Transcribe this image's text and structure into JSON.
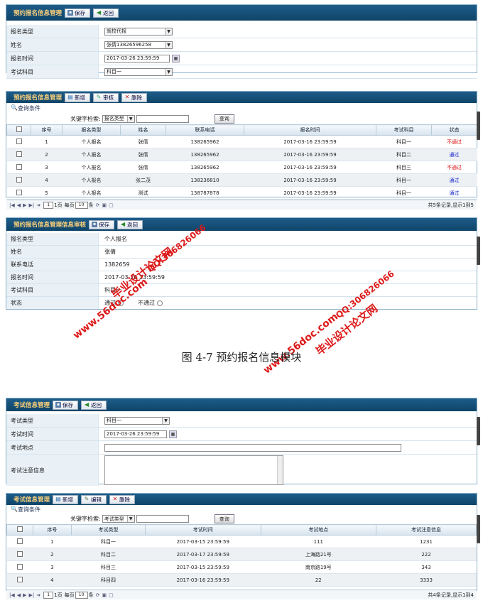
{
  "panel1": {
    "title": "预约报名信息管理",
    "save_label": "保存",
    "back_label": "返回",
    "fields": [
      {
        "label": "报名类型",
        "value": "就校代报",
        "kind": "select"
      },
      {
        "label": "姓名",
        "value": "张倩13826596258",
        "kind": "select"
      },
      {
        "label": "报名时间",
        "value": "2017-03-26 23:59:59",
        "kind": "date"
      },
      {
        "label": "考试科目",
        "value": "科目一",
        "kind": "select"
      }
    ]
  },
  "panel2": {
    "title": "预约报名信息管理",
    "add_label": "新增",
    "audit_label": "审核",
    "delete_label": "删除",
    "query_conditions": "查询条件",
    "keyword_label": "关键字检索:",
    "keyword_select": "报名类型",
    "query_button": "查询",
    "columns": [
      "序号",
      "报名类型",
      "姓名",
      "联系电话",
      "报名时间",
      "考试科目",
      "状态"
    ],
    "rows": [
      [
        "1",
        "个人报名",
        "张倩",
        "138265962",
        "2017-03-16 23:59:59",
        "科目一",
        "不通过"
      ],
      [
        "2",
        "个人报名",
        "张倩",
        "138265962",
        "2017-03-16 23:59:59",
        "科目二",
        "通过"
      ],
      [
        "3",
        "个人报名",
        "张倩",
        "138265962",
        "2017-03-16 23:59:59",
        "科目三",
        "不通过"
      ],
      [
        "4",
        "个人报名",
        "张二茂",
        "138236810",
        "2017-03-16 23:59:59",
        "科目一",
        "通过"
      ],
      [
        "5",
        "个人报名",
        "测试",
        "138787878",
        "2017-03-16 23:59:59",
        "科目一",
        "通过"
      ]
    ],
    "pager": {
      "page": "1",
      "total_pages": "1页",
      "per_page_label": "每页",
      "per_page": "10",
      "unit": "条",
      "summary": "共5条记录,显示1到5"
    }
  },
  "panel3": {
    "title": "预约报名信息管理信息审核",
    "save_label": "保存",
    "back_label": "返回",
    "fields": [
      {
        "label": "报名类型",
        "value": "个人报名"
      },
      {
        "label": "姓名",
        "value": "张倩"
      },
      {
        "label": "联系电话",
        "value": "1382659"
      },
      {
        "label": "报名时间",
        "value": "2017-03-26 23:59:59"
      },
      {
        "label": "考试科目",
        "value": "科目一"
      },
      {
        "label": "状态",
        "value": "通过",
        "value2": "不通过"
      }
    ]
  },
  "caption": "图 4-7  预约报名信息模块",
  "watermarks": {
    "qq": "QQ:306826066",
    "site": "www.56doc.com",
    "brand": "毕业设计论文网"
  },
  "panel4": {
    "title": "考试信息管理",
    "save_label": "保存",
    "back_label": "返回",
    "fields": [
      {
        "label": "考试类型",
        "value": "科目一",
        "kind": "select"
      },
      {
        "label": "考试时间",
        "value": "2017-03-26 23:59:59",
        "kind": "date"
      },
      {
        "label": "考试地点",
        "value": "",
        "kind": "wide"
      },
      {
        "label": "考试注意信息",
        "value": "",
        "kind": "textarea"
      }
    ]
  },
  "panel5": {
    "title": "考试信息管理",
    "add_label": "新增",
    "edit_label": "编辑",
    "delete_label": "删除",
    "query_conditions": "查询条件",
    "keyword_label": "关键字检索:",
    "keyword_select": "考试类型",
    "query_button": "查询",
    "columns": [
      "序号",
      "考试类型",
      "考试时间",
      "考试地点",
      "考试注意信息"
    ],
    "rows": [
      [
        "1",
        "科目一",
        "2017-03-15 23:59:59",
        "111",
        "1231"
      ],
      [
        "2",
        "科目二",
        "2017-03-17 23:59:59",
        "上海路21号",
        "222"
      ],
      [
        "3",
        "科目三",
        "2017-03-15 23:59:59",
        "南京路19号",
        "343"
      ],
      [
        "4",
        "科目四",
        "2017-03-16 23:59:59",
        "22",
        "3333"
      ]
    ],
    "pager": {
      "page": "1",
      "total_pages": "1页",
      "per_page_label": "每页",
      "per_page": "10",
      "unit": "条",
      "summary": "共4条记录,显示1到4"
    }
  }
}
